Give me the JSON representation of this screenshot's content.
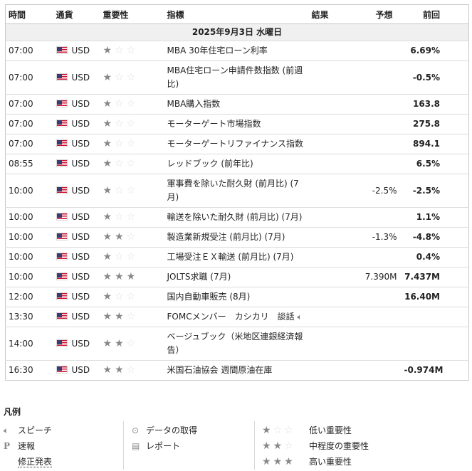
{
  "table": {
    "headers": {
      "time": "時間",
      "currency": "通貨",
      "importance": "重要性",
      "indicator": "指標",
      "result": "結果",
      "forecast": "予想",
      "previous": "前回"
    },
    "date": "2025年9月3日 水曜日",
    "rows": [
      {
        "time": "07:00",
        "currency": "USD",
        "stars": 1,
        "indicator": "MBA 30年住宅ローン利率",
        "result": "",
        "forecast": "",
        "previous": "6.69%",
        "speech": false
      },
      {
        "time": "07:00",
        "currency": "USD",
        "stars": 1,
        "indicator": "MBA住宅ローン申請件数指数 (前週比)",
        "result": "",
        "forecast": "",
        "previous": "-0.5%",
        "speech": false
      },
      {
        "time": "07:00",
        "currency": "USD",
        "stars": 1,
        "indicator": "MBA購入指数",
        "result": "",
        "forecast": "",
        "previous": "163.8",
        "speech": false
      },
      {
        "time": "07:00",
        "currency": "USD",
        "stars": 1,
        "indicator": "モーターゲート市場指数",
        "result": "",
        "forecast": "",
        "previous": "275.8",
        "speech": false
      },
      {
        "time": "07:00",
        "currency": "USD",
        "stars": 1,
        "indicator": "モーターゲートリファイナンス指数",
        "result": "",
        "forecast": "",
        "previous": "894.1",
        "speech": false
      },
      {
        "time": "08:55",
        "currency": "USD",
        "stars": 1,
        "indicator": "レッドブック (前年比)",
        "result": "",
        "forecast": "",
        "previous": "6.5%",
        "speech": false
      },
      {
        "time": "10:00",
        "currency": "USD",
        "stars": 1,
        "indicator": "軍事費を除いた耐久財 (前月比) (7月)",
        "result": "",
        "forecast": "-2.5%",
        "previous": "-2.5%",
        "speech": false
      },
      {
        "time": "10:00",
        "currency": "USD",
        "stars": 1,
        "indicator": "輸送を除いた耐久財 (前月比) (7月)",
        "result": "",
        "forecast": "",
        "previous": "1.1%",
        "speech": false
      },
      {
        "time": "10:00",
        "currency": "USD",
        "stars": 2,
        "indicator": "製造業新規受注 (前月比) (7月)",
        "result": "",
        "forecast": "-1.3%",
        "previous": "-4.8%",
        "speech": false
      },
      {
        "time": "10:00",
        "currency": "USD",
        "stars": 1,
        "indicator": "工場受注ＥＸ輸送 (前月比) (7月)",
        "result": "",
        "forecast": "",
        "previous": "0.4%",
        "speech": false
      },
      {
        "time": "10:00",
        "currency": "USD",
        "stars": 3,
        "indicator": "JOLTS求職 (7月)",
        "result": "",
        "forecast": "7.390M",
        "previous": "7.437M",
        "speech": false
      },
      {
        "time": "12:00",
        "currency": "USD",
        "stars": 1,
        "indicator": "国内自動車販売 (8月)",
        "result": "",
        "forecast": "",
        "previous": "16.40M",
        "speech": false
      },
      {
        "time": "13:30",
        "currency": "USD",
        "stars": 2,
        "indicator": "FOMCメンバー　カシカリ　談話",
        "result": "",
        "forecast": "",
        "previous": "",
        "speech": true
      },
      {
        "time": "14:00",
        "currency": "USD",
        "stars": 2,
        "indicator": "ベージュブック（米地区連銀経済報告）",
        "result": "",
        "forecast": "",
        "previous": "",
        "speech": false
      },
      {
        "time": "16:30",
        "currency": "USD",
        "stars": 2,
        "indicator": "米国石油協会 週間原油在庫",
        "result": "",
        "forecast": "",
        "previous": "-0.974M",
        "speech": false
      }
    ]
  },
  "legend": {
    "title": "凡例",
    "speech": "スピーチ",
    "flash": "速報",
    "revised": "修正発表",
    "data_retrieval": "データの取得",
    "report": "レポート",
    "low": "低い重要性",
    "medium": "中程度の重要性",
    "high": "高い重要性"
  }
}
